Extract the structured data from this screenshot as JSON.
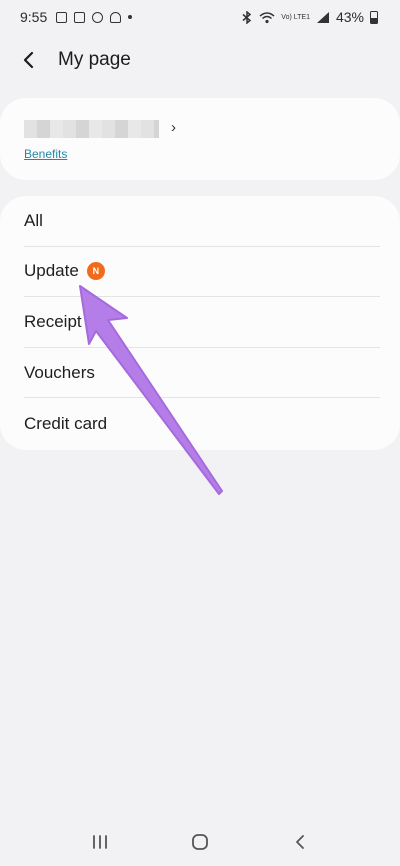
{
  "status_bar": {
    "time": "9:55",
    "network_label": "Vo) LTE1",
    "battery": "43%"
  },
  "header": {
    "title": "My page",
    "back_icon": "chevron-left-icon"
  },
  "account": {
    "benefits_label": "Benefits"
  },
  "menu": {
    "items": [
      {
        "label": "All"
      },
      {
        "label": "Update",
        "badge": "N"
      },
      {
        "label": "Receipt"
      },
      {
        "label": "Vouchers"
      },
      {
        "label": "Credit card"
      }
    ]
  },
  "colors": {
    "background": "#f2f1f4",
    "card": "#fcfcfc",
    "badge": "#f26b1d",
    "link": "#1f8aa8",
    "annotation_arrow": "#b57de8"
  },
  "nav_bar": {
    "icons": [
      "recent-apps-icon",
      "home-icon",
      "back-icon"
    ]
  }
}
